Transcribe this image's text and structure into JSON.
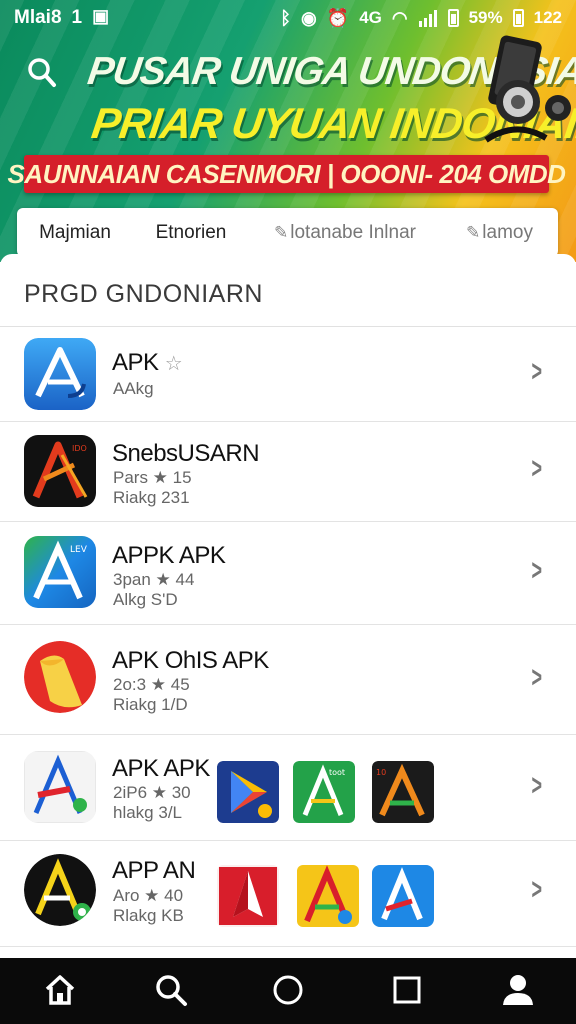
{
  "status_bar": {
    "carrier": "Mlai8",
    "time_left": "1",
    "signal_text": "4G",
    "battery": "59%",
    "time": "122"
  },
  "banner": {
    "line1": "PUSAR UNIGA UNDONESIAI",
    "line2": "PRIAR UYUAN INDONIAIII",
    "ribbon": "SAUNNAIAN CASENMORI | OOONI- 204 OMDD"
  },
  "tabs": [
    {
      "label": "Majmian",
      "active": false
    },
    {
      "label": "Etnorien",
      "active": true
    },
    {
      "label": "lotanabe Inlnar",
      "active": false
    },
    {
      "label": "lamoy",
      "active": false
    }
  ],
  "section_title": "PRGD GNDONIARN",
  "apps": [
    {
      "name": "APK",
      "meta1": "AAkg",
      "meta2": ""
    },
    {
      "name": "SnebsUSARN",
      "meta1": "Pars ★ 15",
      "meta2": "Riakg    231"
    },
    {
      "name": "APPK APK",
      "meta1": "3pan ★ 44",
      "meta2": "Alkg    S'D"
    },
    {
      "name": "APK  OhIS APK",
      "meta1": "2o:3 ★ 45",
      "meta2": "Riakg    1/D"
    },
    {
      "name": "APK APK",
      "meta1": "2iP6 ★ 30",
      "meta2": "hlakg    3/L"
    },
    {
      "name": "APP AN",
      "meta1": "Aro ★ 40",
      "meta2": "Rlakg    KB"
    }
  ],
  "colors": {
    "header_green": "#15a070",
    "header_yellow": "#f4c21c",
    "ribbon_red": "#d51f2a",
    "tab_indicator": "#10946a",
    "nav_bg": "#0a0a0a"
  },
  "icons": {
    "search": "search-icon",
    "home": "home-icon",
    "circle": "circle-home-icon",
    "square": "recents-icon",
    "profile": "profile-icon",
    "chevron": "chevron-right-icon"
  }
}
